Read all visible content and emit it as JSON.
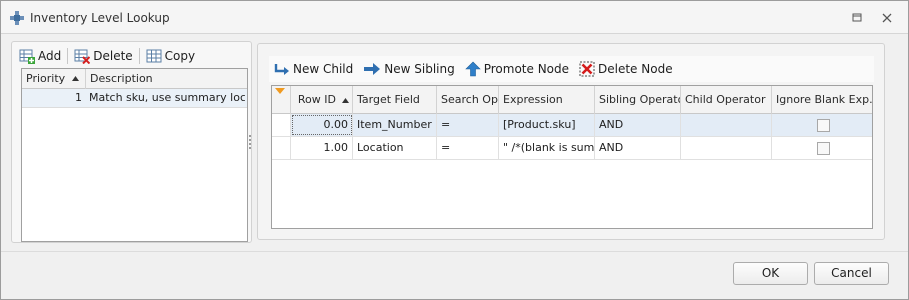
{
  "window": {
    "title": "Inventory Level Lookup"
  },
  "left": {
    "toolbar": {
      "add": "Add",
      "delete": "Delete",
      "copy": "Copy"
    },
    "columns": [
      "Priority",
      "Description"
    ],
    "rows": [
      {
        "priority": "1",
        "description": "Match sku, use summary locat..."
      }
    ]
  },
  "right": {
    "toolbar": {
      "new_child": "New Child",
      "new_sibling": "New Sibling",
      "promote": "Promote Node",
      "delete": "Delete Node"
    },
    "columns": [
      "Row ID",
      "Target Field",
      "Search Op",
      "Expression",
      "Sibling Operator",
      "Child Operator",
      "Ignore Blank Exp..."
    ],
    "rows": [
      {
        "row_id": "0.00",
        "target_field": "Item_Number",
        "search_op": "=",
        "expression": "[Product.sku]",
        "sibling_op": "AND",
        "child_op": "",
        "ignore_blank": false
      },
      {
        "row_id": "1.00",
        "target_field": "Location",
        "search_op": "=",
        "expression": "\" /*(blank is sum...",
        "sibling_op": "AND",
        "child_op": "",
        "ignore_blank": false
      }
    ]
  },
  "footer": {
    "ok": "OK",
    "cancel": "Cancel"
  },
  "colors": {
    "selected_row": "#e3ecf6",
    "window_bg": "#f0f0f0"
  }
}
